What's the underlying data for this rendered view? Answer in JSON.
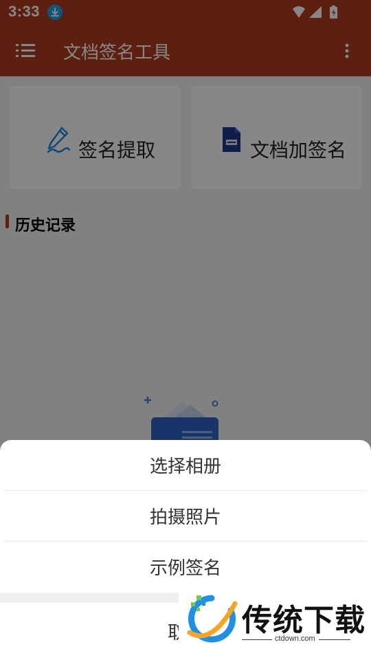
{
  "status_bar": {
    "time": "3:33",
    "download_icon": "download-icon",
    "wifi_icon": "wifi-icon",
    "signal_icon": "signal-icon",
    "battery_icon": "battery-charging-icon"
  },
  "app_bar": {
    "title": "文档签名工具",
    "menu_icon": "list-icon",
    "more_icon": "more-vert-icon",
    "color": "#b03d1f"
  },
  "cards": [
    {
      "label": "签名提取",
      "icon": "pen-icon"
    },
    {
      "label": "文档加签名",
      "icon": "document-icon"
    }
  ],
  "section": {
    "title": "历史记录"
  },
  "sheet": {
    "options": [
      "选择相册",
      "拍摄照片",
      "示例签名"
    ],
    "cancel": "取消"
  },
  "watermark": {
    "brand": "传统下载",
    "site": "ctdown.com"
  }
}
